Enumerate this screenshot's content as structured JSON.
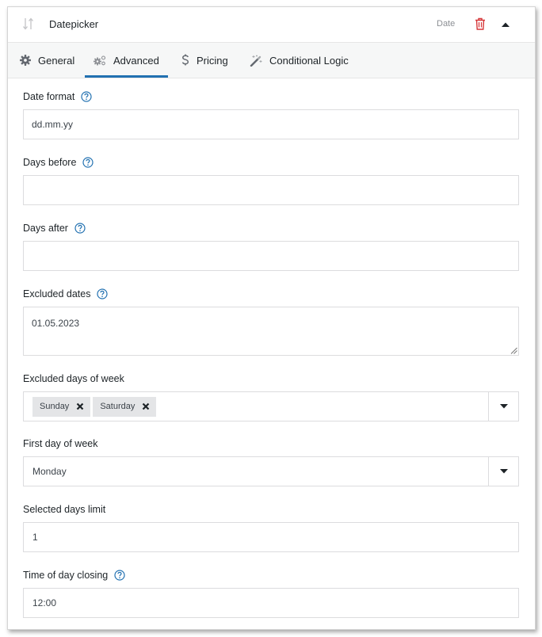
{
  "header": {
    "title": "Datepicker",
    "type_label": "Date",
    "colors": {
      "trash": "#d63638",
      "accent": "#2271b1"
    }
  },
  "tabs": [
    {
      "label": "General",
      "icon": "gear-icon",
      "active": false
    },
    {
      "label": "Advanced",
      "icon": "gears-icon",
      "active": true
    },
    {
      "label": "Pricing",
      "icon": "dollar-icon",
      "active": false
    },
    {
      "label": "Conditional Logic",
      "icon": "magic-wand-icon",
      "active": false
    }
  ],
  "fields": {
    "date_format": {
      "label": "Date format",
      "value": "dd.mm.yy",
      "has_help": true
    },
    "days_before": {
      "label": "Days before",
      "value": "",
      "has_help": true
    },
    "days_after": {
      "label": "Days after",
      "value": "",
      "has_help": true
    },
    "excluded_dates": {
      "label": "Excluded dates",
      "value": "01.05.2023",
      "has_help": true
    },
    "excluded_days_of_week": {
      "label": "Excluded days of week",
      "selected": [
        "Sunday",
        "Saturday"
      ]
    },
    "first_day_of_week": {
      "label": "First day of week",
      "value": "Monday"
    },
    "selected_days_limit": {
      "label": "Selected days limit",
      "value": "1"
    },
    "time_of_day_closing": {
      "label": "Time of day closing",
      "value": "12:00",
      "has_help": true
    }
  }
}
